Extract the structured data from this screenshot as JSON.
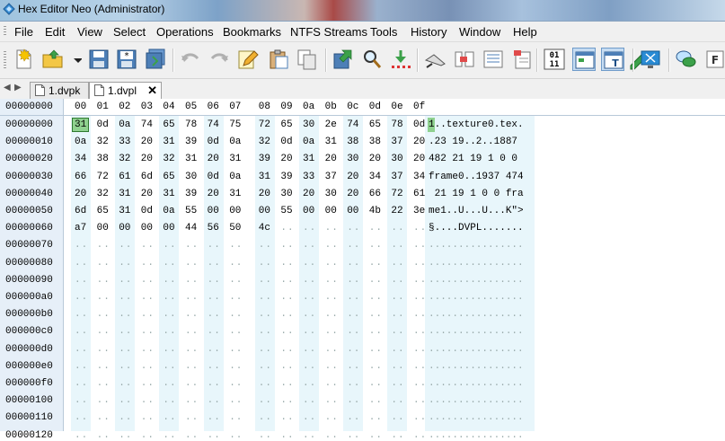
{
  "window": {
    "title": "Hex Editor Neo (Administrator)"
  },
  "menu": [
    "File",
    "Edit",
    "View",
    "Select",
    "Operations",
    "Bookmarks",
    "NTFS Streams",
    "Tools",
    "History",
    "Window",
    "Help"
  ],
  "toolbar": {
    "buttons": [
      {
        "name": "new-file-icon"
      },
      {
        "name": "open-folder-icon"
      },
      {
        "name": "open-dropdown-icon"
      },
      {
        "name": "save-icon"
      },
      {
        "name": "save-as-icon"
      },
      {
        "name": "save-all-icon"
      },
      {
        "name": "undo-icon"
      },
      {
        "name": "redo-icon"
      },
      {
        "name": "edit-pencil-icon"
      },
      {
        "name": "paste-icon"
      },
      {
        "name": "copy-icon"
      },
      {
        "name": "export-icon"
      },
      {
        "name": "find-icon"
      },
      {
        "name": "goto-icon"
      },
      {
        "name": "bookmark-icon"
      },
      {
        "name": "columns-icon"
      },
      {
        "name": "patterns-icon"
      },
      {
        "name": "structure-icon"
      },
      {
        "name": "hex-view-icon",
        "label": "01\n11"
      },
      {
        "name": "view-mode-1-icon"
      },
      {
        "name": "view-mode-2-icon"
      },
      {
        "name": "highlight-icon"
      },
      {
        "name": "screen-icon"
      },
      {
        "name": "chat-icon"
      },
      {
        "name": "more-icon"
      }
    ]
  },
  "tabs": [
    {
      "label": "1.dvpk",
      "active": false
    },
    {
      "label": "1.dvpl",
      "active": true
    }
  ],
  "tab_close_glyph": "✕",
  "hex": {
    "corner_offset": "00000000",
    "columns": [
      "00",
      "01",
      "02",
      "03",
      "04",
      "05",
      "06",
      "07",
      "08",
      "09",
      "0a",
      "0b",
      "0c",
      "0d",
      "0e",
      "0f"
    ],
    "rows": [
      {
        "offset": "00000000",
        "bytes": [
          "31",
          "0d",
          "0a",
          "74",
          "65",
          "78",
          "74",
          "75",
          "72",
          "65",
          "30",
          "2e",
          "74",
          "65",
          "78",
          "0d"
        ],
        "text": "1..texture0.tex."
      },
      {
        "offset": "00000010",
        "bytes": [
          "0a",
          "32",
          "33",
          "20",
          "31",
          "39",
          "0d",
          "0a",
          "32",
          "0d",
          "0a",
          "31",
          "38",
          "38",
          "37",
          "20"
        ],
        "text": ".23 19..2..1887 "
      },
      {
        "offset": "00000020",
        "bytes": [
          "34",
          "38",
          "32",
          "20",
          "32",
          "31",
          "20",
          "31",
          "39",
          "20",
          "31",
          "20",
          "30",
          "20",
          "30",
          "20"
        ],
        "text": "482 21 19 1 0 0 "
      },
      {
        "offset": "00000030",
        "bytes": [
          "66",
          "72",
          "61",
          "6d",
          "65",
          "30",
          "0d",
          "0a",
          "31",
          "39",
          "33",
          "37",
          "20",
          "34",
          "37",
          "34"
        ],
        "text": "frame0..1937 474"
      },
      {
        "offset": "00000040",
        "bytes": [
          "20",
          "32",
          "31",
          "20",
          "31",
          "39",
          "20",
          "31",
          "20",
          "30",
          "20",
          "30",
          "20",
          "66",
          "72",
          "61"
        ],
        "text": " 21 19 1 0 0 fra"
      },
      {
        "offset": "00000050",
        "bytes": [
          "6d",
          "65",
          "31",
          "0d",
          "0a",
          "55",
          "00",
          "00",
          "00",
          "55",
          "00",
          "00",
          "00",
          "4b",
          "22",
          "3e"
        ],
        "text": "me1..U...U...K\">"
      },
      {
        "offset": "00000060",
        "bytes": [
          "a7",
          "00",
          "00",
          "00",
          "00",
          "44",
          "56",
          "50",
          "4c",
          "..",
          "..",
          "..",
          "..",
          "..",
          "..",
          ".."
        ],
        "text": "§....DVPL......."
      },
      {
        "offset": "00000070",
        "bytes": [],
        "text": ""
      },
      {
        "offset": "00000080",
        "bytes": [],
        "text": ""
      },
      {
        "offset": "00000090",
        "bytes": [],
        "text": ""
      },
      {
        "offset": "000000a0",
        "bytes": [],
        "text": ""
      },
      {
        "offset": "000000b0",
        "bytes": [],
        "text": ""
      },
      {
        "offset": "000000c0",
        "bytes": [],
        "text": ""
      },
      {
        "offset": "000000d0",
        "bytes": [],
        "text": ""
      },
      {
        "offset": "000000e0",
        "bytes": [],
        "text": ""
      },
      {
        "offset": "000000f0",
        "bytes": [],
        "text": ""
      },
      {
        "offset": "00000100",
        "bytes": [],
        "text": ""
      },
      {
        "offset": "00000110",
        "bytes": [],
        "text": ""
      },
      {
        "offset": "00000120",
        "bytes": [],
        "text": ""
      }
    ],
    "empty_byte": "..",
    "empty_text": "................",
    "cursor_byte": "31"
  },
  "colors": {
    "column_stripe": "#e8f6fb",
    "offset_bg": "#e6eff8",
    "cursor": "#8fd18f"
  }
}
